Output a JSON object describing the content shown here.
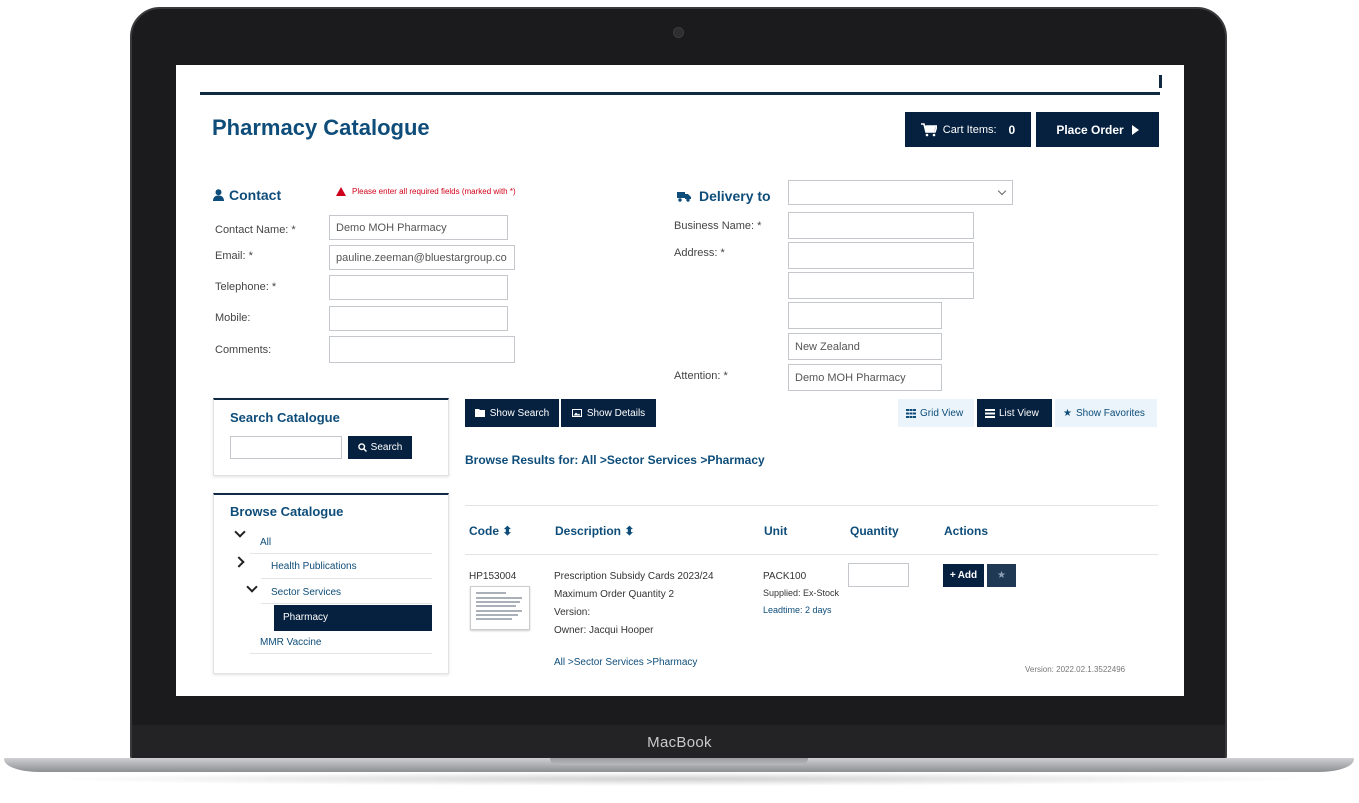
{
  "device": {
    "brand": "MacBook"
  },
  "header": {
    "title": "Pharmacy Catalogue",
    "cart_label": "Cart Items:",
    "cart_count": "0",
    "place_order_label": "Place Order"
  },
  "contact": {
    "heading": "Contact",
    "warning": "Please enter all required fields (marked with *)",
    "fields": [
      {
        "label": "Contact Name: *",
        "value": "Demo MOH Pharmacy"
      },
      {
        "label": "Email: *",
        "value": "pauline.zeeman@bluestargroup.co"
      },
      {
        "label": "Telephone: *",
        "value": ""
      },
      {
        "label": "Mobile:",
        "value": ""
      },
      {
        "label": "Comments:",
        "value": ""
      }
    ]
  },
  "delivery": {
    "heading": "Delivery to",
    "selected": "",
    "business_label": "Business Name: *",
    "business_value": "",
    "address_label": "Address: *",
    "address_lines": [
      "",
      "",
      "",
      "New Zealand"
    ],
    "attention_label": "Attention: *",
    "attention_value": "Demo MOH Pharmacy"
  },
  "search": {
    "title": "Search Catalogue",
    "placeholder": "",
    "button": "Search"
  },
  "toolbar": {
    "show_search": "Show Search",
    "show_details": "Show Details",
    "grid_view": "Grid View",
    "list_view": "List View",
    "show_favorites": "Show Favorites"
  },
  "browse_results": "Browse Results for: All >Sector Services >Pharmacy",
  "browse": {
    "title": "Browse Catalogue",
    "all": "All",
    "health_publications": "Health Publications",
    "sector_services": "Sector Services",
    "pharmacy": "Pharmacy",
    "mmr_vaccine": "MMR Vaccine"
  },
  "table": {
    "headers": {
      "code": "Code",
      "description": "Description",
      "unit": "Unit",
      "quantity": "Quantity",
      "actions": "Actions"
    },
    "rows": [
      {
        "code": "HP153004",
        "desc_title": "Prescription Subsidy Cards 2023/24",
        "desc_max": "Maximum Order Quantity 2",
        "desc_version": "Version:",
        "desc_owner": "Owner: Jacqui Hooper",
        "unit": "PACK100",
        "supplied": "Supplied: Ex-Stock",
        "leadtime": "Leadtime: 2 days",
        "quantity": "",
        "add_label": "Add",
        "category_path": "All >Sector Services >Pharmacy"
      }
    ]
  },
  "footer": {
    "version": "Version: 2022.02.1.3522496"
  },
  "colors": {
    "primary": "#06213f",
    "accent": "#0e4d7a",
    "warning": "#d0021b"
  }
}
